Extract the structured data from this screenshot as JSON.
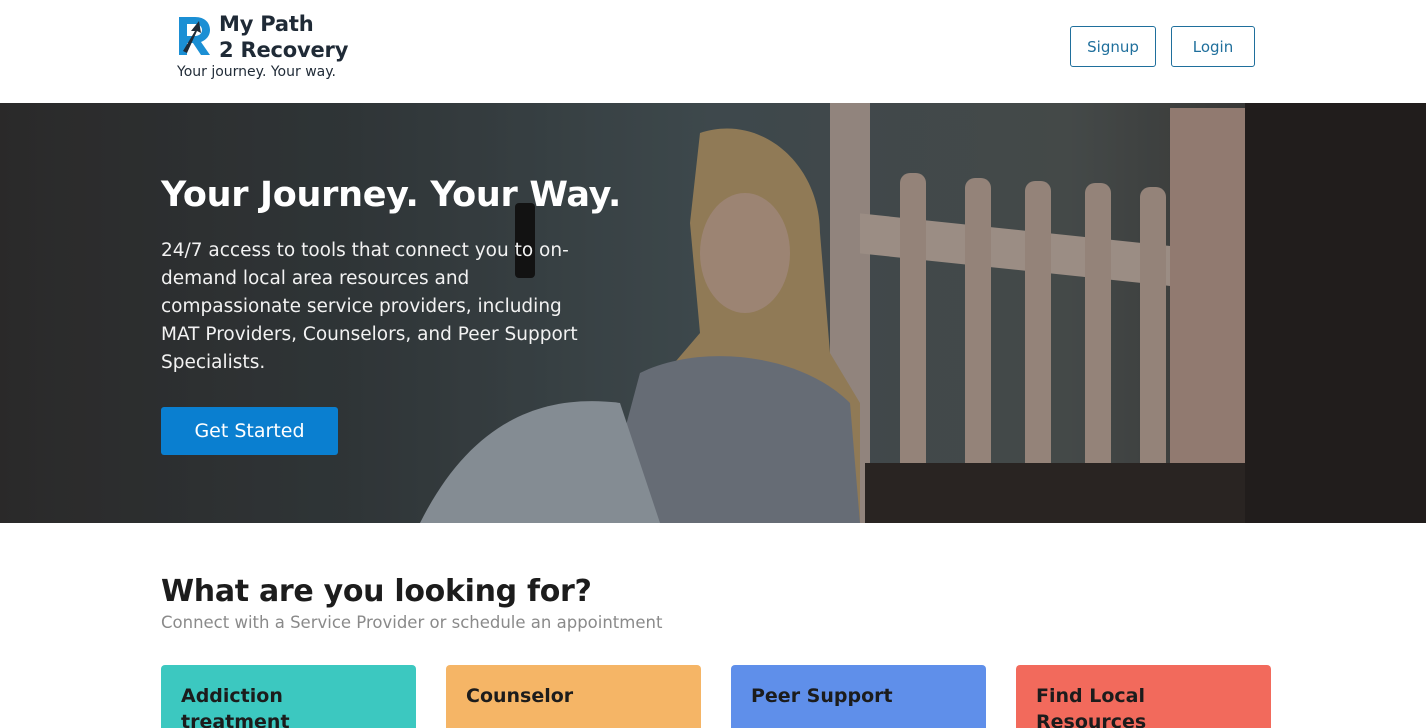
{
  "header": {
    "logo_line1": "My Path",
    "logo_line2": "2 Recovery",
    "tagline": "Your journey. Your way.",
    "signup_label": "Signup",
    "login_label": "Login"
  },
  "hero": {
    "title": "Your Journey. Your Way.",
    "description": "24/7 access to tools that connect you to on-demand local area resources and compassionate service providers, including MAT Providers, Counselors, and Peer Support Specialists.",
    "cta_label": "Get Started"
  },
  "section": {
    "title": "What are you looking for?",
    "subtitle": "Connect with a Service Provider or schedule an appointment",
    "cards": [
      {
        "label": "Addiction treatment providers MAT",
        "color": "#3cc8c0"
      },
      {
        "label": "Counselor",
        "color": "#f5b566"
      },
      {
        "label": "Peer Support",
        "color": "#5f8fea"
      },
      {
        "label": "Find Local Resources",
        "color": "#f26a5c"
      }
    ]
  },
  "colors": {
    "accent": "#0a7fd0",
    "outline_button": "#1f6f9c",
    "logo_blue": "#1b8fd4"
  }
}
